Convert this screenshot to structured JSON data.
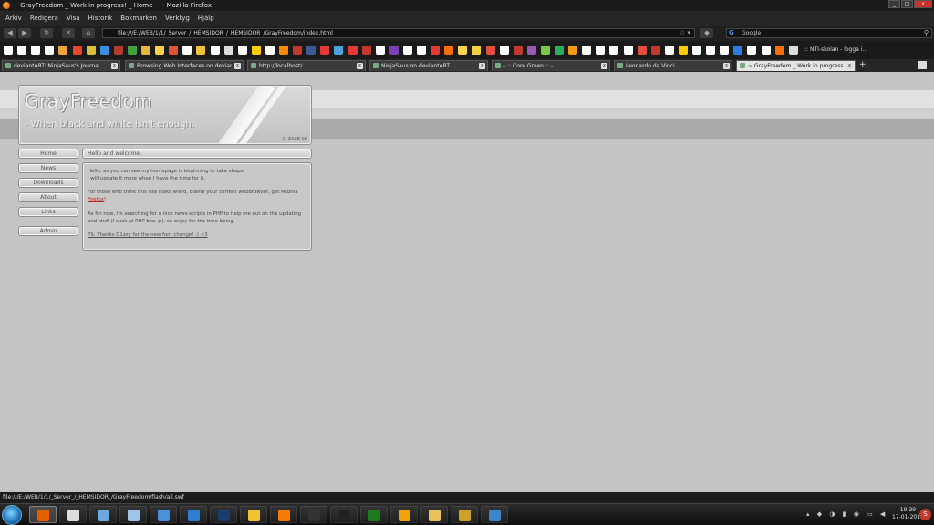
{
  "window": {
    "title": "~ GrayFreedom _ Work in progress! _ Home ~ - Mozilla Firefox",
    "controls": {
      "min": "_",
      "max": "□",
      "close": "x"
    }
  },
  "menu": [
    "Arkiv",
    "Redigera",
    "Visa",
    "Historik",
    "Bokmärken",
    "Verktyg",
    "Hjälp"
  ],
  "nav": {
    "url": "file:///E:/WEB/1/1/_Server_/_HEMSIDOR_/_HEMSIDOR_/GrayFreedom/index.html",
    "search_placeholder": "Google",
    "url_star": "☆ ▾"
  },
  "bookmarks": {
    "last_label": ":: NTI-skolan - logga i...",
    "colors": [
      "#ffffff",
      "#ffffff",
      "#ffffff",
      "#ffffff",
      "#f2a23a",
      "#e8452e",
      "#d8c23d",
      "#3c8ce0",
      "#b33b2e",
      "#3ea23e",
      "#e2b73c",
      "#ffd04a",
      "#dd5533",
      "#ffffff",
      "#f2c23c",
      "#ffffff",
      "#dddddd",
      "#ffffff",
      "#ffcc00",
      "#ffffff",
      "#ff8800",
      "#c0392b",
      "#3b5998",
      "#e53935",
      "#4aa3df",
      "#e53935",
      "#c0392b",
      "#ffffff",
      "#7a3fb3",
      "#ffffff",
      "#ffffff",
      "#e53935",
      "#ff6f00",
      "#ffd54f",
      "#f4d03f",
      "#e74c3c",
      "#ffffff",
      "#c0392b",
      "#9b59b6",
      "#7ac943",
      "#27ae60",
      "#f39c12",
      "#ffffff",
      "#ffffff",
      "#ffffff",
      "#ffffff",
      "#e74c3c",
      "#c0392b",
      "#ffffff",
      "#ffcc00",
      "#ffffff",
      "#ffffff",
      "#ffffff",
      "#2c7be5",
      "#ffffff",
      "#ffffff",
      "#ff6f00",
      "#dddddd"
    ]
  },
  "tabs": [
    {
      "label": "deviantART: NinjaSaus's Journal",
      "active": false
    },
    {
      "label": "Browsing Web Interfaces on deviant...",
      "active": false
    },
    {
      "label": "http://localhost/",
      "active": false
    },
    {
      "label": "NinjaSaus on deviantART",
      "active": false
    },
    {
      "label": "- :: Core Green :: -",
      "active": false
    },
    {
      "label": "Leonardo da Vinci",
      "active": false
    },
    {
      "label": "~ GrayFreedom _ Work in progress...",
      "active": true
    }
  ],
  "site": {
    "logo": "GrayFreedom",
    "tagline": "- When black and white isn't enough.",
    "copyright": "© ZACE 08",
    "nav": [
      "Home",
      "News",
      "Downloads",
      "About",
      "Links",
      "Admin"
    ],
    "welcome": "Hello and welcome.",
    "paragraphs": {
      "p1_line1": "Hello, as you can see my homepage is beginning to take shape.",
      "p1_line2": "I will update it more when I have the time for it.",
      "p2_line1": "For those who think this site looks wierd, blame your current webbrowser, get Mozilla",
      "p2_link": "Firefox",
      "p2_end": "!",
      "p3_line1": "As for now, Im searching for a nice news-scripts in PHP to help me out on the updating",
      "p3_line2": "and stuff (I suck at PHP btw :p), so enjoy for the time being.",
      "ps": "PS: Thanks D1zzy for the new font change! :) <3"
    }
  },
  "status": "file:///E:/WEB/1/1/_Server_/_HEMSIDOR_/GrayFreedom/flash/all.swf",
  "taskbar": {
    "apps": [
      {
        "name": "firefox",
        "color": "#e66000",
        "active": true
      },
      {
        "name": "wolf",
        "color": "#dddddd",
        "active": false
      },
      {
        "name": "windows-explorer",
        "color": "#6fa8dc",
        "active": false
      },
      {
        "name": "notepad",
        "color": "#9fc5e8",
        "active": false
      },
      {
        "name": "messenger",
        "color": "#4a90d9",
        "active": false
      },
      {
        "name": "blue-file",
        "color": "#2d7fd3",
        "active": false
      },
      {
        "name": "photoshop",
        "color": "#1b3e6f",
        "active": false
      },
      {
        "name": "honeycomb",
        "color": "#f1c232",
        "active": false
      },
      {
        "name": "blender",
        "color": "#f57c00",
        "active": false
      },
      {
        "name": "udk",
        "color": "#333333",
        "active": false
      },
      {
        "name": "steam",
        "color": "#222222",
        "active": false
      },
      {
        "name": "green-app",
        "color": "#1e7a1e",
        "active": false
      },
      {
        "name": "z-app",
        "color": "#f1a10a",
        "active": false
      },
      {
        "name": "folder",
        "color": "#e8c25a",
        "active": false
      },
      {
        "name": "explorer",
        "color": "#c9a227",
        "active": false
      },
      {
        "name": "media-player",
        "color": "#3d85c6",
        "active": false
      }
    ],
    "tray": "▴ ◆ ◑ ▮ ◉ ▭ ◀",
    "time": "19:39",
    "date": "17-01-2010",
    "red_icon": "S"
  }
}
